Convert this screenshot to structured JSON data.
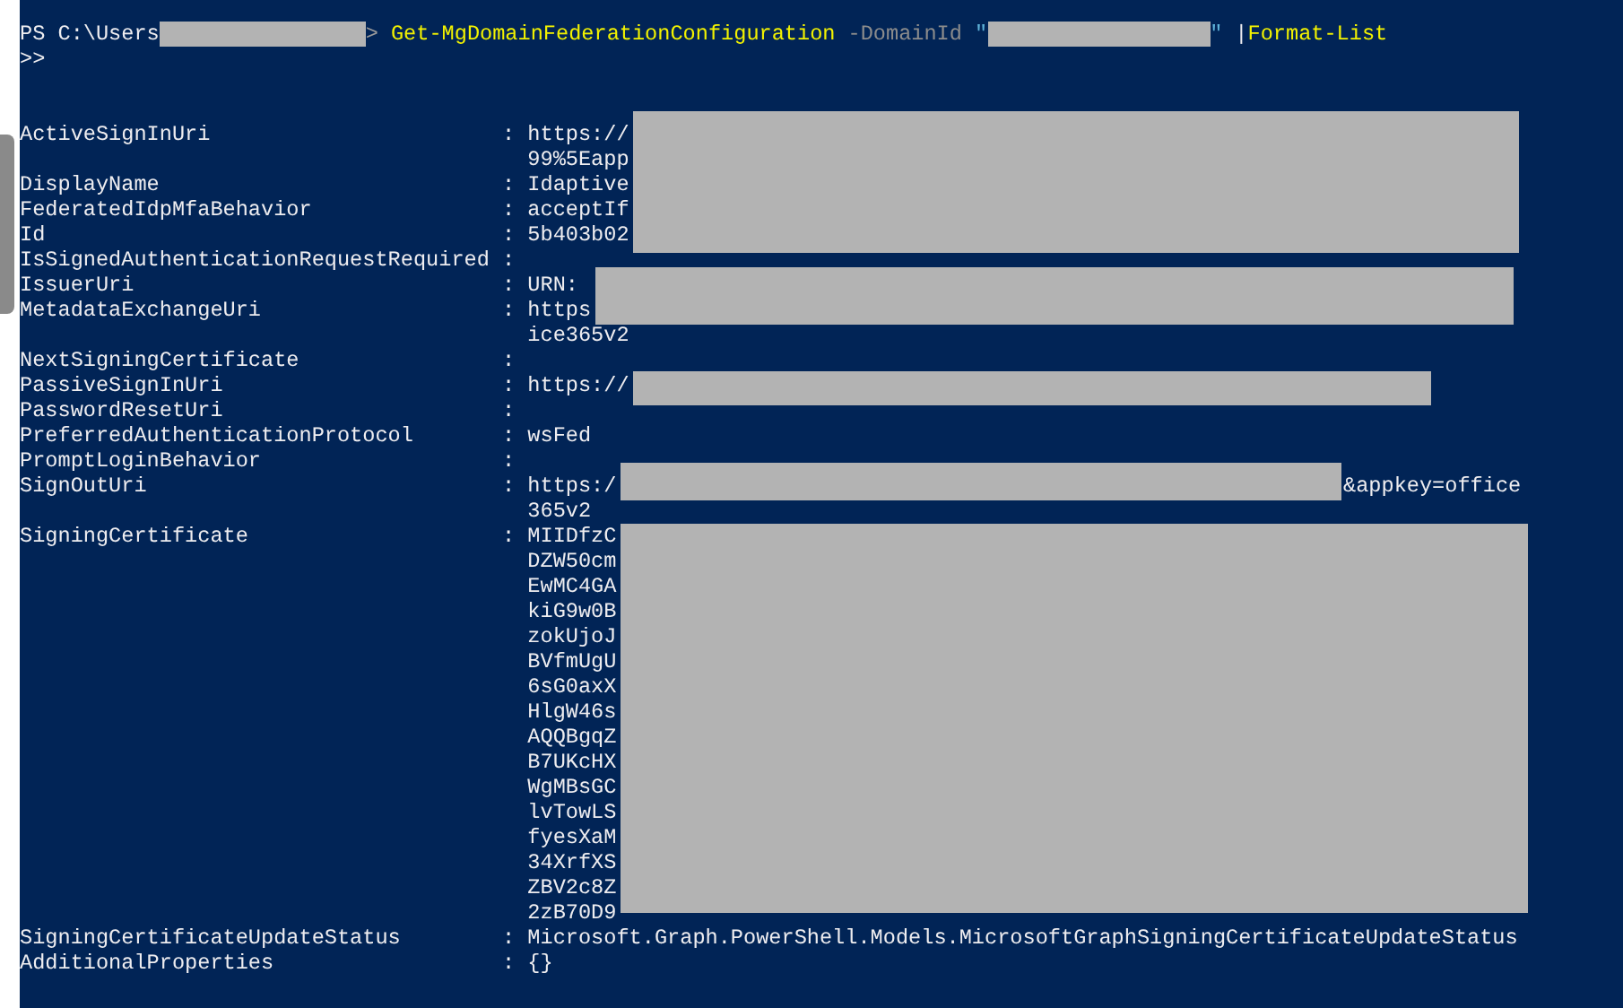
{
  "prompt": {
    "path": "PS C:\\Users",
    "suffix": ">"
  },
  "command": {
    "cmdlet": "Get-MgDomainFederationConfiguration",
    "parameter": "-DomainId",
    "quote_open": "\"",
    "quote_close": "\"",
    "pipe": "|",
    "pipe_cmdlet": "Format-List"
  },
  "continuation": ">>",
  "properties": [
    {
      "name": "ActiveSignInUri",
      "value_lines": [
        ": https://",
        "99%5Eapp"
      ]
    },
    {
      "name": "DisplayName",
      "value_lines": [
        ": Idaptive"
      ]
    },
    {
      "name": "FederatedIdpMfaBehavior",
      "value_lines": [
        ": acceptIf"
      ]
    },
    {
      "name": "Id",
      "value_lines": [
        ": 5b403b02"
      ]
    },
    {
      "name": "IsSignedAuthenticationRequestRequired",
      "value_lines": [
        ":"
      ]
    },
    {
      "name": "IssuerUri",
      "value_lines": [
        ": URN:"
      ]
    },
    {
      "name": "MetadataExchangeUri",
      "value_lines": [
        ": https",
        "ice365v2"
      ]
    },
    {
      "name": "NextSigningCertificate",
      "value_lines": [
        ":"
      ]
    },
    {
      "name": "PassiveSignInUri",
      "value_lines": [
        ": https://"
      ]
    },
    {
      "name": "PasswordResetUri",
      "value_lines": [
        ":"
      ]
    },
    {
      "name": "PreferredAuthenticationProtocol",
      "value_lines": [
        ": wsFed"
      ]
    },
    {
      "name": "PromptLoginBehavior",
      "value_lines": [
        ":"
      ]
    },
    {
      "name": "SignOutUri",
      "value_lines": [
        ": https:/",
        "365v2"
      ],
      "tail": "&appkey=office"
    },
    {
      "name": "SigningCertificate",
      "value_lines": [
        ": MIIDfzC",
        "DZW50cm",
        "EwMC4GA",
        "kiG9w0B",
        "zokUjoJ",
        "BVfmUgU",
        "6sG0axX",
        "HlgW46s",
        "AQQBgqZ",
        "B7UKcHX",
        "WgMBsGC",
        "lvTowLS",
        "fyesXaM",
        "34XrfXS",
        "ZBV2c8Z",
        "2zB70D9"
      ]
    },
    {
      "name": "SigningCertificateUpdateStatus",
      "value_lines": [
        ": Microsoft.Graph.PowerShell.Models.MicrosoftGraphSigningCertificateUpdateStatus"
      ]
    },
    {
      "name": "AdditionalProperties",
      "value_lines": [
        ": {}"
      ]
    }
  ]
}
